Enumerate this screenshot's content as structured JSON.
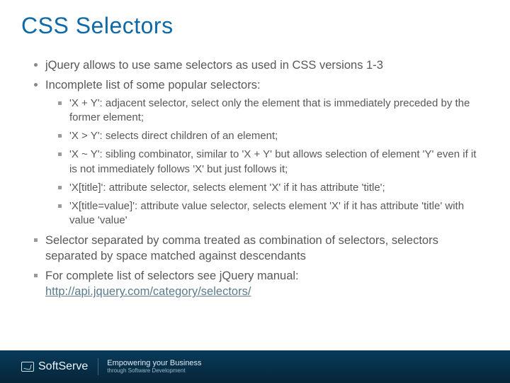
{
  "title": "CSS Selectors",
  "bullets": {
    "b1": "jQuery allows to use same selectors as used in CSS versions 1-3",
    "b2": "Incomplete list of some popular selectors:",
    "sub": {
      "s1": "'X + Y': adjacent selector, select only the element that is immediately preceded by the former element;",
      "s2": "'X > Y': selects direct children of an element;",
      "s3": "'X ~ Y': sibling combinator, similar to 'X + Y' but allows selection of element 'Y' even if it is not immediately follows 'X' but just follows it;",
      "s4": "'X[title]': attribute selector, selects element 'X' if it has attribute 'title';",
      "s5": "'X[title=value]': attribute value selector, selects element 'X' if it has attribute 'title' with value 'value'"
    },
    "b3": "Selector separated by comma treated as combination of selectors, selectors separated by space matched against descendants",
    "b4": "For complete list of selectors see jQuery manual: ",
    "link": "http://api.jquery.com/category/selectors/"
  },
  "footer": {
    "brand": "SoftServe",
    "tagline_main": "Empowering your Business",
    "tagline_sub": "through Software Development"
  }
}
